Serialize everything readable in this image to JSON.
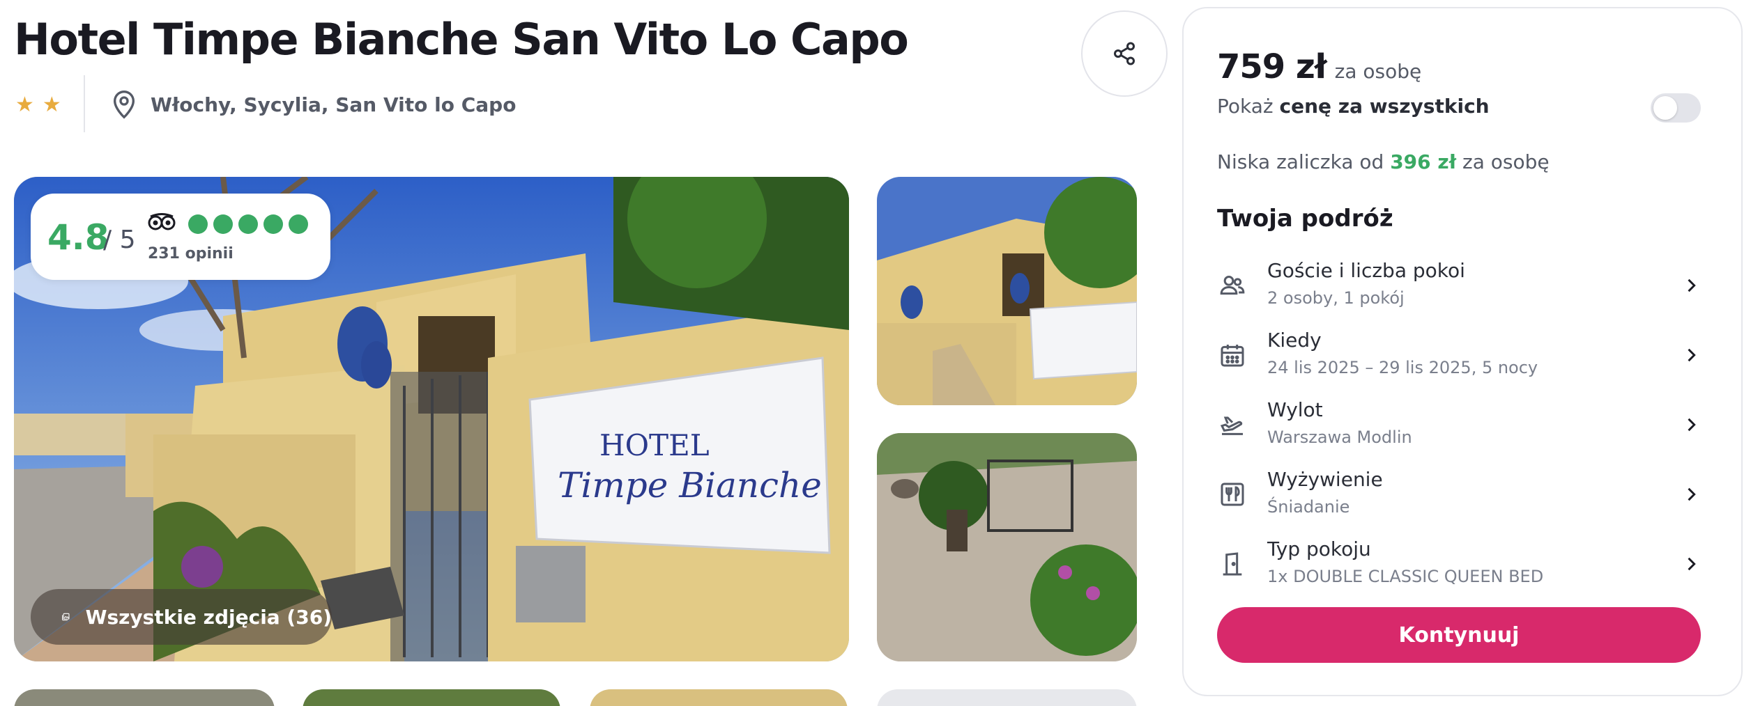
{
  "hotel": {
    "title": "Hotel Timpe Bianche San Vito Lo Capo",
    "stars": 2,
    "location": "Włochy, Sycylia, San Vito lo Capo"
  },
  "rating": {
    "score": "4.8",
    "out_of": "/ 5",
    "bubbles": 5,
    "reviews": "231 opinii"
  },
  "gallery": {
    "all_photos_label": "Wszystkie zdjęcia (36)",
    "sign_line1": "HOTEL",
    "sign_line2": "Timpe Bianche"
  },
  "booking": {
    "price": "759 zł",
    "price_unit": "za osobę",
    "show_total_prefix": "Pokaż",
    "show_total_bold": "cenę za wszystkich",
    "toggle_on": false,
    "deposit_prefix": "Niska zaliczka od",
    "deposit_amount": "396 zł",
    "deposit_suffix": "za osobę",
    "trip_title": "Twoja podróż",
    "rows": [
      {
        "icon": "guests-icon",
        "label": "Goście i liczba pokoi",
        "value": "2 osoby, 1 pokój"
      },
      {
        "icon": "calendar-icon",
        "label": "Kiedy",
        "value": "24 lis 2025 – 29 lis 2025, 5 nocy"
      },
      {
        "icon": "plane-departure-icon",
        "label": "Wylot",
        "value": "Warszawa Modlin"
      },
      {
        "icon": "cutlery-icon",
        "label": "Wyżywienie",
        "value": "Śniadanie"
      },
      {
        "icon": "door-icon",
        "label": "Typ pokoju",
        "value": "1x DOUBLE CLASSIC QUEEN BED"
      }
    ],
    "cta_label": "Kontynuuj"
  },
  "colors": {
    "accent": "#d8296b",
    "rating_green": "#3aa963",
    "star_gold": "#e8ab3e"
  }
}
